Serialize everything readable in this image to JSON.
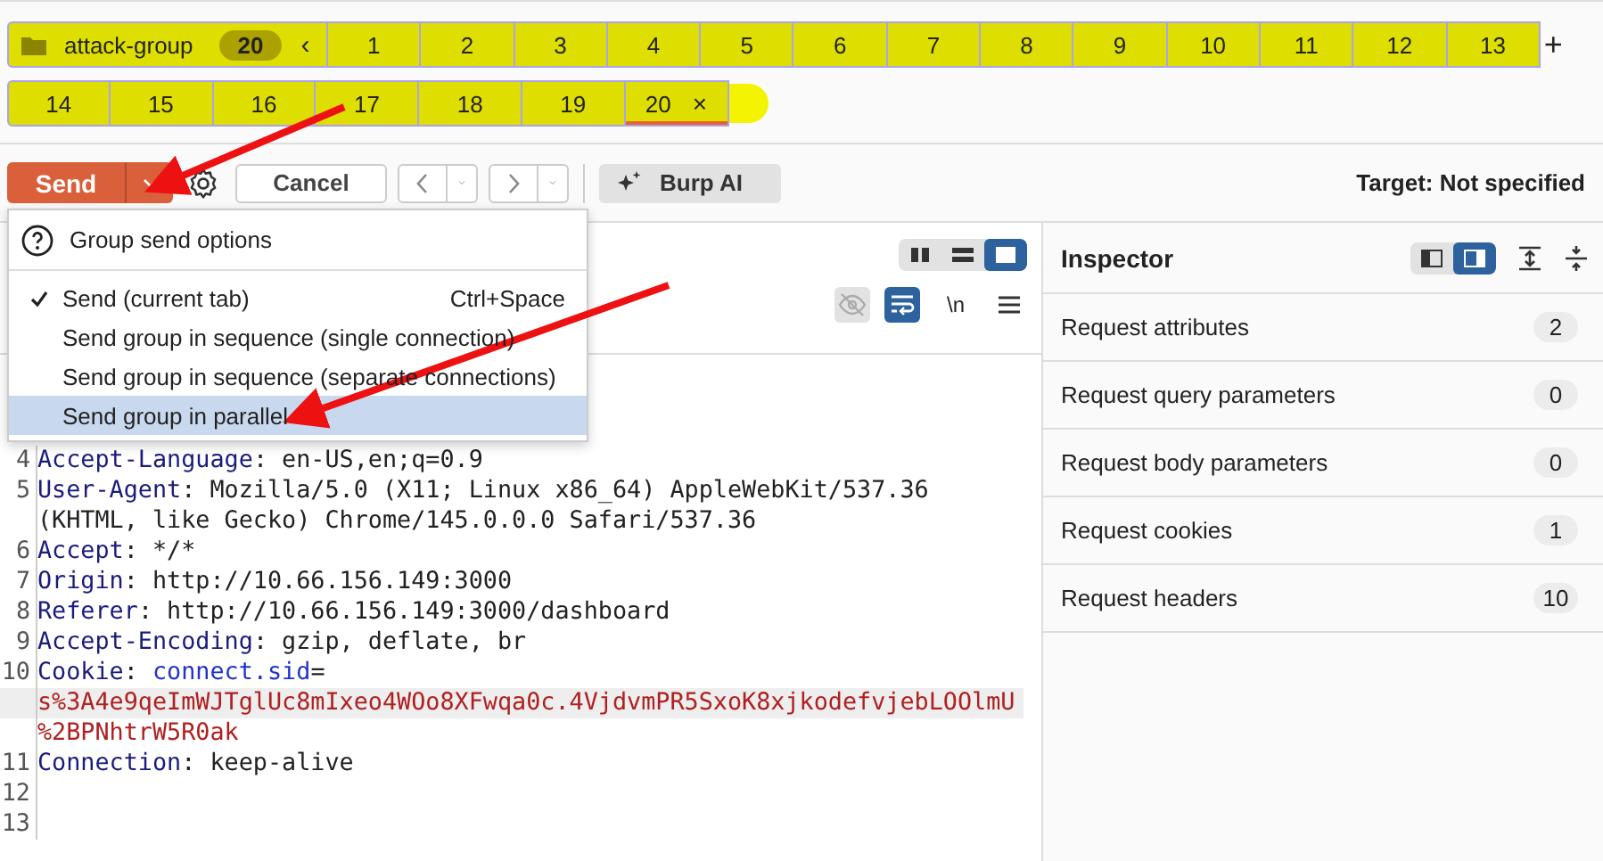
{
  "tab_group": {
    "name": "attack-group",
    "count": "20",
    "collapse": "‹",
    "add": "+"
  },
  "tab_rows": [
    {
      "tabs": [
        {
          "label": "1",
          "selected": false
        },
        {
          "label": "2",
          "selected": false
        },
        {
          "label": "3",
          "selected": false
        },
        {
          "label": "4",
          "selected": false
        },
        {
          "label": "5",
          "selected": false
        },
        {
          "label": "6",
          "selected": false
        },
        {
          "label": "7",
          "selected": false
        },
        {
          "label": "8",
          "selected": false
        },
        {
          "label": "9",
          "selected": false
        },
        {
          "label": "10",
          "selected": false
        },
        {
          "label": "11",
          "selected": false
        },
        {
          "label": "12",
          "selected": false
        },
        {
          "label": "13",
          "selected": false
        }
      ]
    },
    {
      "tabs": [
        {
          "label": "14",
          "selected": false
        },
        {
          "label": "15",
          "selected": false
        },
        {
          "label": "16",
          "selected": false
        },
        {
          "label": "17",
          "selected": false
        },
        {
          "label": "18",
          "selected": false
        },
        {
          "label": "19",
          "selected": false
        },
        {
          "label": "20",
          "selected": true,
          "close": "×"
        }
      ]
    }
  ],
  "toolbar": {
    "send": "Send",
    "cancel": "Cancel",
    "burp_ai": "Burp AI",
    "target": "Target: Not specified"
  },
  "send_menu": {
    "title": "Group send options",
    "items": [
      {
        "label": "Send (current tab)",
        "shortcut": "Ctrl+Space",
        "checked": true,
        "selected": false
      },
      {
        "label": "Send group in sequence (single connection)",
        "checked": false,
        "selected": false
      },
      {
        "label": "Send group in sequence (separate connections)",
        "checked": false,
        "selected": false
      },
      {
        "label": "Send group in parallel",
        "checked": false,
        "selected": true
      }
    ]
  },
  "editor": {
    "view_modes": [
      {
        "selected": false
      },
      {
        "selected": false
      },
      {
        "selected": true
      }
    ],
    "tools": [
      {
        "kind": "eye-off",
        "on": false
      },
      {
        "kind": "wrap",
        "on": true
      },
      {
        "kind": "newline",
        "label": "\\n",
        "on": false
      },
      {
        "kind": "menu",
        "on": false
      }
    ],
    "lines": [
      {
        "number": "4",
        "parts": [
          {
            "kind": "name",
            "text": "Accept-Language"
          },
          {
            "kind": "plain",
            "text": ": en-US,en;q=0.9"
          }
        ]
      },
      {
        "number": "5",
        "parts": [
          {
            "kind": "name",
            "text": "User-Agent"
          },
          {
            "kind": "plain",
            "text": ": Mozilla/5.0 (X11; Linux x86_64) AppleWebKit/537.36"
          }
        ]
      },
      {
        "parts": [
          {
            "kind": "plain",
            "text": "(KHTML, like Gecko) Chrome/145.0.0.0 Safari/537.36"
          }
        ]
      },
      {
        "number": "6",
        "parts": [
          {
            "kind": "name",
            "text": "Accept"
          },
          {
            "kind": "plain",
            "text": ": */*"
          }
        ]
      },
      {
        "number": "7",
        "parts": [
          {
            "kind": "name",
            "text": "Origin"
          },
          {
            "kind": "plain",
            "text": ": http://10.66.156.149:3000"
          }
        ]
      },
      {
        "number": "8",
        "parts": [
          {
            "kind": "name",
            "text": "Referer"
          },
          {
            "kind": "plain",
            "text": ": http://10.66.156.149:3000/dashboard"
          }
        ]
      },
      {
        "number": "9",
        "parts": [
          {
            "kind": "name",
            "text": "Accept-Encoding"
          },
          {
            "kind": "plain",
            "text": ": gzip, deflate, br"
          }
        ]
      },
      {
        "number": "10",
        "parts": [
          {
            "kind": "name",
            "text": "Cookie"
          },
          {
            "kind": "plain",
            "text": ": "
          },
          {
            "kind": "cookie-name",
            "text": "connect.sid"
          },
          {
            "kind": "plain",
            "text": "="
          }
        ]
      },
      {
        "highlighted": true,
        "parts": [
          {
            "kind": "cookie-value",
            "text": "s%3A4e9qeImWJTglUc8mIxeo4WOo8XFwqa0c.4VjdvmPR5SxoK8xjkodefvjebLOOlmU"
          }
        ]
      },
      {
        "parts": [
          {
            "kind": "cookie-value",
            "text": "%2BPNhtrW5R0ak"
          }
        ]
      },
      {
        "number": "11",
        "parts": [
          {
            "kind": "name",
            "text": "Connection"
          },
          {
            "kind": "plain",
            "text": ": keep-alive"
          }
        ]
      },
      {
        "number": "12"
      },
      {
        "number": "13"
      }
    ]
  },
  "inspector": {
    "title": "Inspector",
    "layouts": [
      {
        "selected": false
      },
      {
        "selected": true
      }
    ],
    "rows": [
      {
        "label": "Request attributes",
        "count": "2"
      },
      {
        "label": "Request query parameters",
        "count": "0"
      },
      {
        "label": "Request body parameters",
        "count": "0"
      },
      {
        "label": "Request cookies",
        "count": "1"
      },
      {
        "label": "Request headers",
        "count": "10"
      }
    ]
  }
}
